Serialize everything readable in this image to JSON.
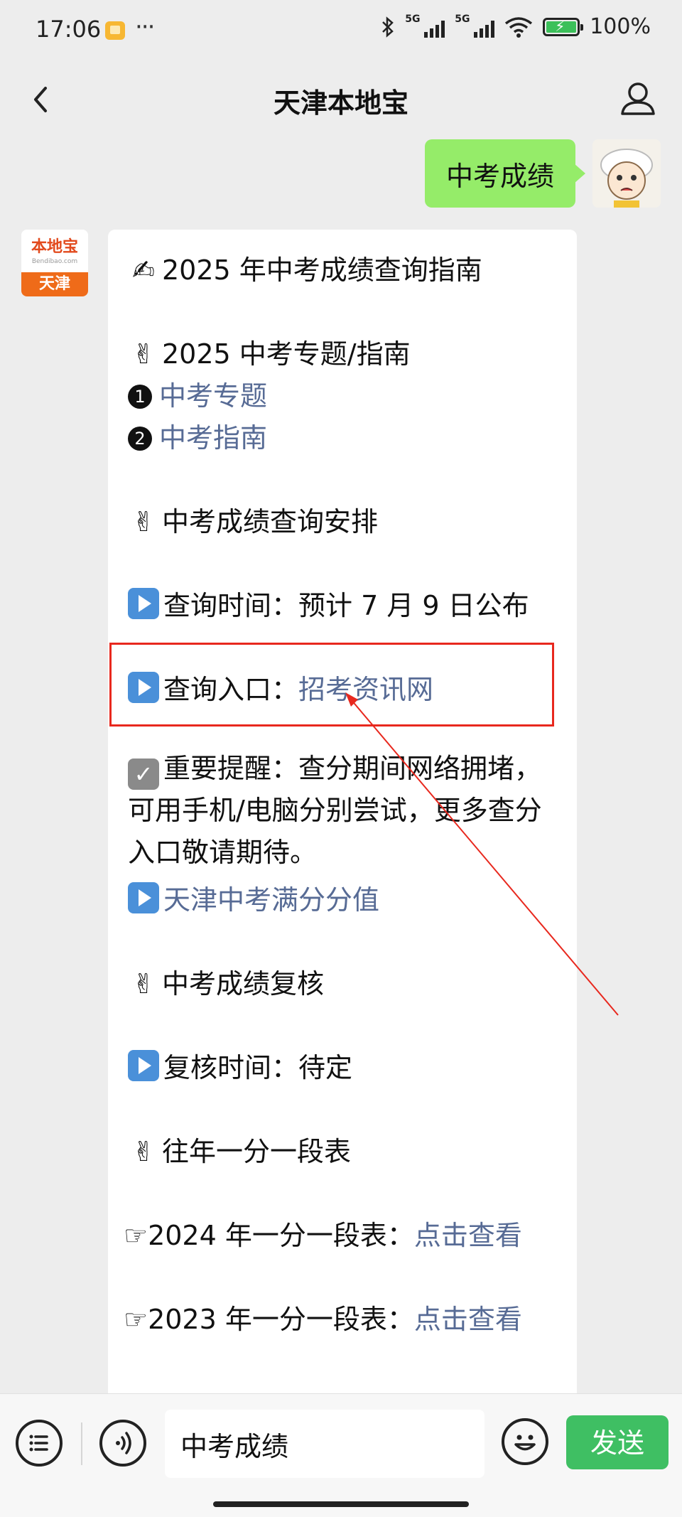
{
  "status_bar": {
    "time": "17:06",
    "more": "···",
    "network_1": "5G",
    "network_2": "5G",
    "battery": "100%"
  },
  "header": {
    "title": "天津本地宝"
  },
  "user_message": {
    "text": "中考成绩"
  },
  "bot": {
    "avatar_brand": "本地宝",
    "avatar_sub": "Bendibao.com",
    "avatar_city": "天津",
    "lines": {
      "l1": "2025 年中考成绩查询指南",
      "l2": "2025 中考专题/指南",
      "badge1": "1",
      "link1": "中考专题",
      "badge2": "2",
      "link2": "中考指南",
      "l3": "中考成绩查询安排",
      "l4": "查询时间：预计 7 月 9 日公布",
      "l5_prefix": "查询入口：",
      "l5_link": "招考资讯网",
      "l6": "重要提醒：查分期间网络拥堵，可用手机/电脑分别尝试，更多查分入口敬请期待。",
      "l7_link": "天津中考满分分值",
      "l8": "中考成绩复核",
      "l9": "复核时间：待定",
      "l10": "往年一分一段表",
      "l11_prefix": "☞2024 年一分一段表：",
      "l11_link": "点击查看",
      "l12_prefix": "☞2023 年一分一段表：",
      "l12_link": "点击查看"
    }
  },
  "input_bar": {
    "value": "中考成绩",
    "send_label": "发送"
  },
  "colors": {
    "link": "#576b95",
    "user_bubble": "#95ec69",
    "send": "#3fbf63",
    "highlight": "#e8281e"
  }
}
